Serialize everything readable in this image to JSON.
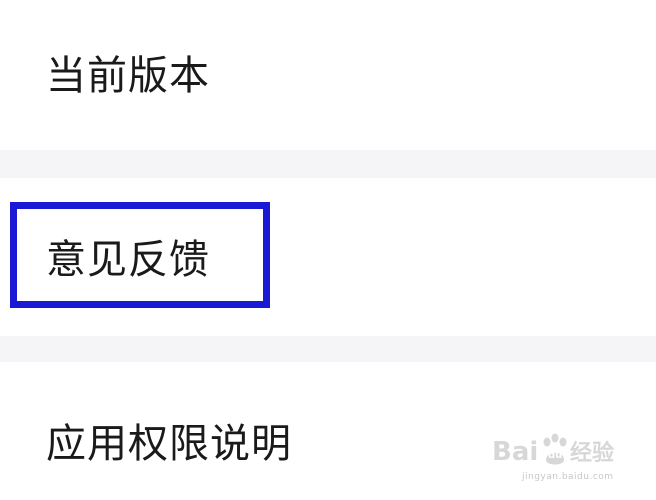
{
  "settings": {
    "items": [
      {
        "label": "当前版本"
      },
      {
        "label": "意见反馈"
      },
      {
        "label": "应用权限说明"
      }
    ]
  },
  "annotation": {
    "highlight_color": "#1a1ad6"
  },
  "watermark": {
    "brand": "Bai du 经验",
    "domain": "jingyan.baidu.com",
    "icon": "baidu-paw-icon"
  },
  "colors": {
    "background": "#ffffff",
    "separator": "#f5f5f7",
    "text": "#1a1a1a"
  }
}
